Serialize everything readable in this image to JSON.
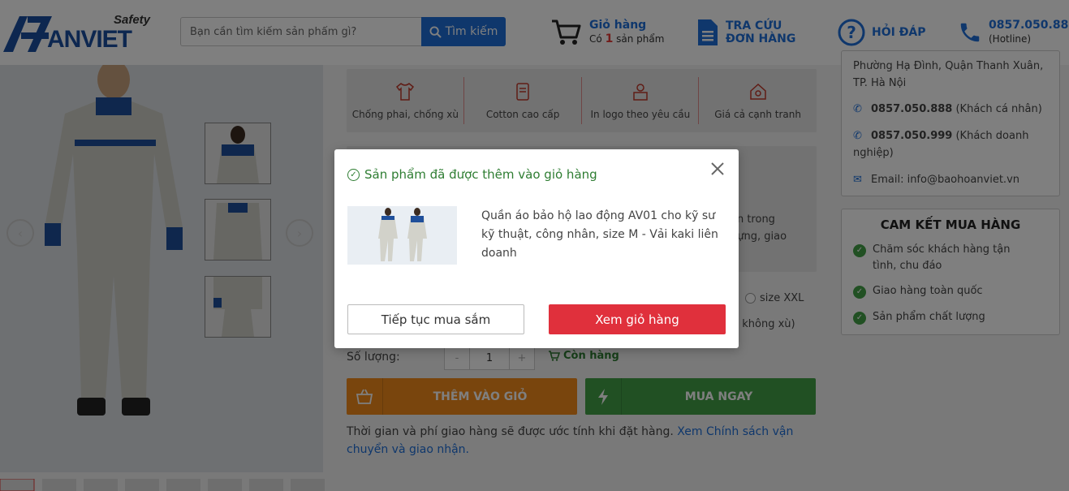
{
  "header": {
    "logo_safety": "Safety",
    "logo_text": "ANVIET",
    "search_placeholder": "Bạn cần tìm kiếm sản phẩm gì?",
    "search_button": "Tìm kiếm",
    "cart_title": "Giỏ hàng",
    "cart_prefix": "Có",
    "cart_count": "1",
    "cart_suffix": "sản phẩm",
    "order_lookup_line1": "TRA CỨU",
    "order_lookup_line2": "ĐƠN HÀNG",
    "faq": "HỎI ĐÁP",
    "hotline_number": "0857.050.888",
    "hotline_label": "(Hotline)"
  },
  "features": [
    {
      "label": "Chống phai, chống xù",
      "icon": "shirt-icon"
    },
    {
      "label": "Cotton cao cấp",
      "icon": "fabric-icon"
    },
    {
      "label": "In logo theo yêu cầu",
      "icon": "print-icon"
    },
    {
      "label": "Giá cả cạnh tranh",
      "icon": "price-icon"
    }
  ],
  "product_info": {
    "partial_text_1": "ận trong",
    "partial_text_2": "dựng, giao",
    "size_option": "size XXL",
    "partial_text_3": ", không xù)",
    "qty_label": "Số lượng:",
    "qty_minus": "-",
    "qty_value": "1",
    "qty_plus": "+",
    "stock_status": "Còn hàng",
    "add_to_cart": "THÊM VÀO GIỎ",
    "buy_now": "MUA NGAY",
    "shipping_note": "Thời gian và phí giao hàng sẽ được ước tính khi đặt hàng.",
    "shipping_link": "Xem Chính sách vận chuyển và giao nhận."
  },
  "contact": {
    "address_partial": "Phường Hạ Đình, Quận Thanh Xuân,",
    "address_city": "TP. Hà Nội",
    "phone1": "0857.050.888",
    "phone1_note": "(Khách cá nhân)",
    "phone2": "0857.050.999",
    "phone2_note": "(Khách doanh nghiệp)",
    "email": "Email: info@baohoanviet.vn"
  },
  "commitment": {
    "title": "CAM KẾT MUA HÀNG",
    "items": [
      "Chăm sóc khách hàng tận tình, chu đáo",
      "Giao hàng toàn quốc",
      "Sản phẩm chất lượng"
    ]
  },
  "modal": {
    "title": "Sản phẩm đã được thêm vào giỏ hàng",
    "product_name": "Quần áo bảo hộ lao động AV01 cho kỹ sư kỹ thuật, công nhân, size M - Vải kaki liên doanh",
    "continue_button": "Tiếp tục mua sắm",
    "view_cart_button": "Xem giỏ hàng"
  },
  "colors": {
    "brand_blue": "#1e6fd9",
    "orange": "#f38b1a",
    "green": "#43a047",
    "red": "#e0303c"
  }
}
